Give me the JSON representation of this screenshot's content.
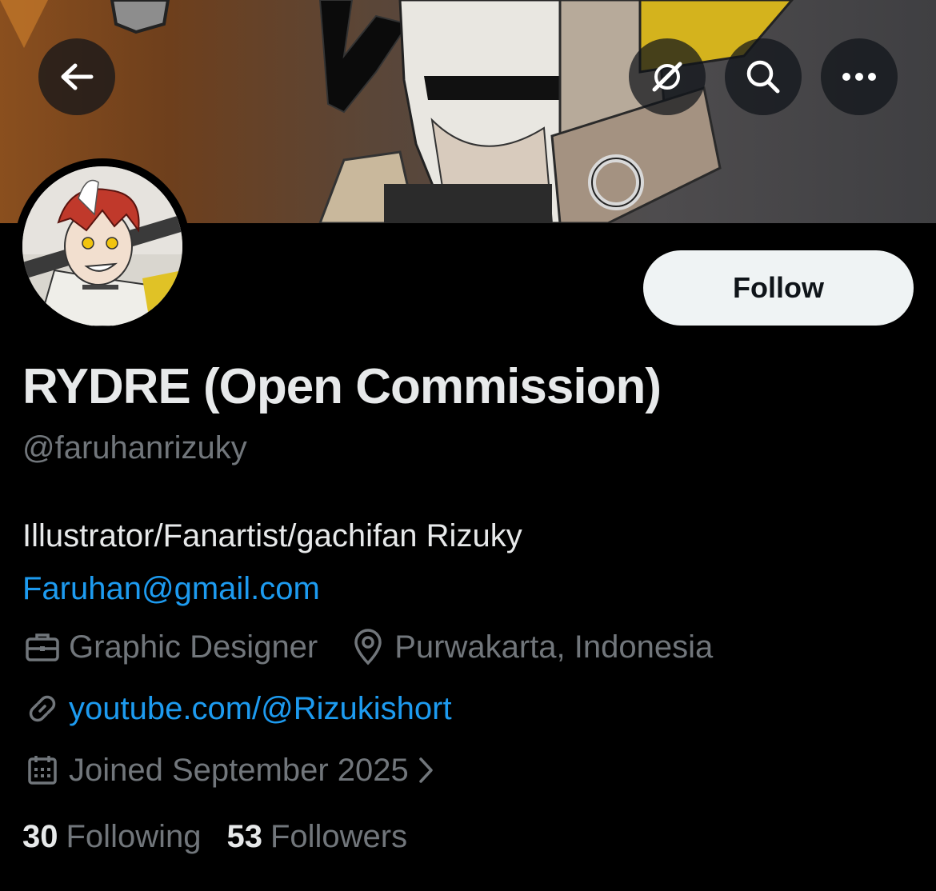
{
  "header": {
    "back_icon": "arrow-left-icon",
    "grok_icon": "grok-icon",
    "search_icon": "search-icon",
    "more_icon": "more-horizontal-icon"
  },
  "profile": {
    "display_name": "RYDRE (Open Commission)",
    "handle": "@faruhanrizuky",
    "follow_label": "Follow",
    "bio_line": "Illustrator/Fanartist/gachifan Rizuky",
    "bio_email": "Faruhan@gmail.com",
    "category": "Graphic Designer",
    "location": "Purwakarta, Indonesia",
    "website": "youtube.com/@Rizukishort",
    "joined": "Joined September 2025",
    "following_count": "30",
    "following_label": "Following",
    "followers_count": "53",
    "followers_label": "Followers"
  },
  "colors": {
    "background": "#000000",
    "text_primary": "#e7e9ea",
    "text_secondary": "#71767b",
    "link": "#1d9bf0",
    "follow_button_bg": "#eff3f4"
  }
}
